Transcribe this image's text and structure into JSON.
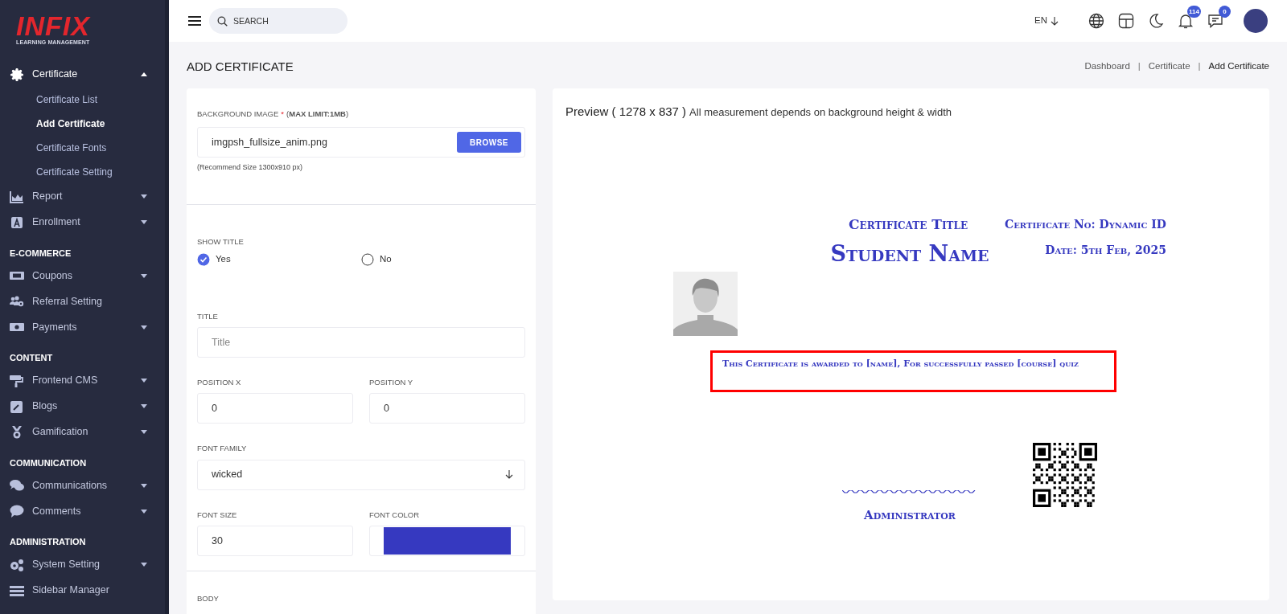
{
  "sidebar": {
    "logo": {
      "brand": "INFIX",
      "tagline": "LEARNING MANAGEMENT"
    },
    "sections": [
      {
        "items": [
          {
            "label": "Certificate",
            "expanded": true,
            "children": [
              {
                "label": "Certificate List",
                "selected": false
              },
              {
                "label": "Add Certificate",
                "selected": true
              },
              {
                "label": "Certificate Fonts",
                "selected": false
              },
              {
                "label": "Certificate Setting",
                "selected": false
              }
            ]
          },
          {
            "label": "Report",
            "expanded": false
          },
          {
            "label": "Enrollment",
            "expanded": false
          }
        ]
      },
      {
        "heading": "E-COMMERCE",
        "items": [
          {
            "label": "Coupons",
            "expanded": false
          },
          {
            "label": "Referral Setting"
          },
          {
            "label": "Payments",
            "expanded": false
          }
        ]
      },
      {
        "heading": "CONTENT",
        "items": [
          {
            "label": "Frontend CMS",
            "expanded": false
          },
          {
            "label": "Blogs",
            "expanded": false
          },
          {
            "label": "Gamification",
            "expanded": false
          }
        ]
      },
      {
        "heading": "COMMUNICATION",
        "items": [
          {
            "label": "Communications",
            "expanded": false
          },
          {
            "label": "Comments",
            "expanded": false
          }
        ]
      },
      {
        "heading": "ADMINISTRATION",
        "items": [
          {
            "label": "System Setting",
            "expanded": false
          },
          {
            "label": "Sidebar Manager"
          }
        ]
      }
    ]
  },
  "topbar": {
    "search": {
      "placeholder": "SEARCH"
    },
    "language": "EN",
    "notifications": {
      "count": "114"
    },
    "messages": {
      "count": "0"
    }
  },
  "page": {
    "title": "ADD CERTIFICATE",
    "breadcrumb": [
      {
        "kind": "link",
        "label": "Dashboard"
      },
      {
        "kind": "separator",
        "label": "|"
      },
      {
        "kind": "link",
        "label": "Certificate"
      },
      {
        "kind": "separator",
        "label": "|"
      },
      {
        "kind": "current",
        "label": "Add Certificate"
      }
    ]
  },
  "form": {
    "background_image": {
      "label": "BACKGROUND IMAGE",
      "required_mark": "*",
      "note": "(**MAX LIMIT:1MB**)",
      "value": "imgpsh_fullsize_anim.png",
      "button": "BROWSE",
      "hint": "(Recommend Size 1300x910 px)"
    },
    "show_title": {
      "label": "SHOW TITLE",
      "options": [
        {
          "label": "Yes",
          "selected": true
        },
        {
          "label": "No",
          "selected": false
        }
      ]
    },
    "title": {
      "label": "TITLE",
      "placeholder": "Title"
    },
    "position_x": {
      "label": "POSITION X",
      "value": "0"
    },
    "position_y": {
      "label": "POSITION Y",
      "value": "0"
    },
    "font_family": {
      "label": "FONT FAMILY",
      "value": "wicked"
    },
    "font_size": {
      "label": "FONT SIZE",
      "value": "30"
    },
    "font_color": {
      "label": "FONT COLOR",
      "color": "#3639c0"
    },
    "body": {
      "label": "BODY"
    }
  },
  "preview": {
    "heading": "Preview ( 1278 x 837 )",
    "note": "All measurement depends on background height & width",
    "certificate": {
      "title": "Certificate Title",
      "student_name": "Student Name",
      "certificate_no": "Certificate No: Dynamic ID",
      "date": "Date: 5th Feb, 2025",
      "body": {
        "text": "This Certificate is awarded to [name], For successfully passed [course] quiz",
        "selected": true
      },
      "signature_label": "Administrator"
    }
  }
}
